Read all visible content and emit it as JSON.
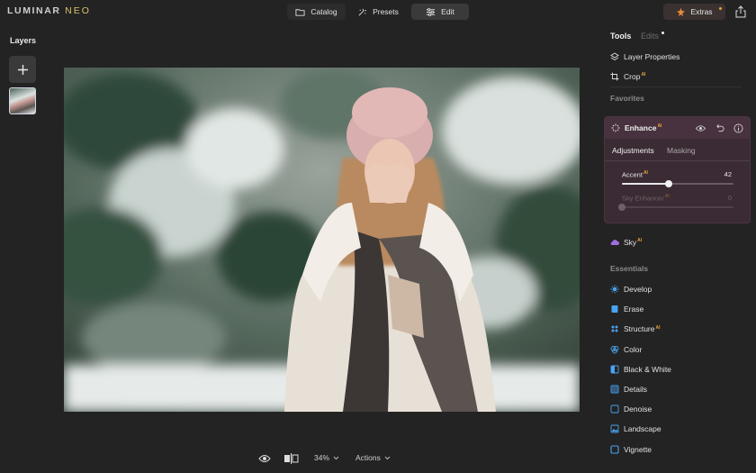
{
  "app": {
    "logo_main": "LUMINAR",
    "logo_accent": "NEO"
  },
  "topbar": {
    "catalog_label": "Catalog",
    "presets_label": "Presets",
    "edit_label": "Edit",
    "extras_label": "Extras"
  },
  "layers": {
    "title": "Layers"
  },
  "bottombar": {
    "zoom": "34%",
    "actions": "Actions"
  },
  "panel": {
    "tools_tab": "Tools",
    "edits_tab": "Edits",
    "layer_properties": "Layer Properties",
    "crop": "Crop",
    "crop_badge": "AI",
    "favorites_heading": "Favorites",
    "enhance": {
      "title": "Enhance",
      "badge": "AI",
      "tab_adjustments": "Adjustments",
      "tab_masking": "Masking",
      "accent_label": "Accent",
      "accent_badge": "AI",
      "accent_value": "42",
      "accent_fraction": 0.42,
      "sky_enhancer_label": "Sky Enhancer",
      "sky_enhancer_badge": "AI",
      "sky_enhancer_value": "0",
      "sky_enhancer_fraction": 0
    },
    "sky": "Sky",
    "sky_badge": "AI",
    "essentials_heading": "Essentials",
    "essentials": [
      {
        "label": "Develop",
        "badge": "",
        "icon": "develop-icon",
        "color": "#4aa3f0"
      },
      {
        "label": "Erase",
        "badge": "",
        "icon": "erase-icon",
        "color": "#4aa3f0"
      },
      {
        "label": "Structure",
        "badge": "AI",
        "icon": "structure-icon",
        "color": "#4aa3f0"
      },
      {
        "label": "Color",
        "badge": "",
        "icon": "color-icon",
        "color": "#4aa3f0"
      },
      {
        "label": "Black & White",
        "badge": "",
        "icon": "black-white-icon",
        "color": "#4aa3f0"
      },
      {
        "label": "Details",
        "badge": "",
        "icon": "details-icon",
        "color": "#4aa3f0"
      },
      {
        "label": "Denoise",
        "badge": "",
        "icon": "denoise-icon",
        "color": "#4aa3f0"
      },
      {
        "label": "Landscape",
        "badge": "",
        "icon": "landscape-icon",
        "color": "#4aa3f0"
      },
      {
        "label": "Vignette",
        "badge": "",
        "icon": "vignette-icon",
        "color": "#4aa3f0"
      }
    ]
  },
  "colors": {
    "background": "#232323",
    "accent_ai": "#e6a23c",
    "tool_icon": "#4aa3f0",
    "sky_icon": "#a06ee0",
    "enhance_card": "#3b2b34"
  }
}
